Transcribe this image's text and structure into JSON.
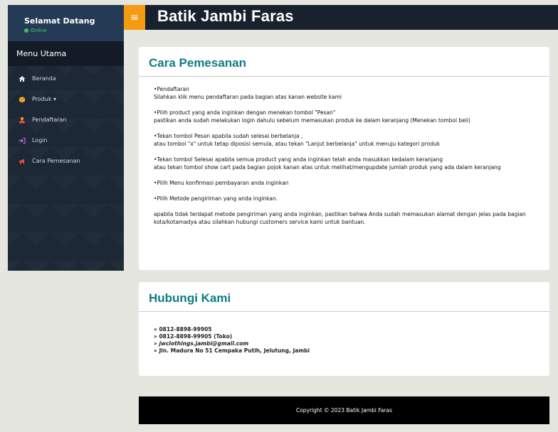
{
  "sidebar": {
    "welcome": "Selamat Datang",
    "status": "Online",
    "menu_header": "Menu Utama",
    "items": [
      {
        "label": "Beranda",
        "icon": "home-icon"
      },
      {
        "label": "Produk ▾",
        "icon": "box-icon"
      },
      {
        "label": "Pendaftaran",
        "icon": "user-icon"
      },
      {
        "label": "Login",
        "icon": "login-icon"
      },
      {
        "label": "Cara Pemesanan",
        "icon": "bullhorn-icon"
      }
    ]
  },
  "header": {
    "toggle": "≡",
    "brand": "Batik Jambi Faras"
  },
  "cara": {
    "title": "Cara Pemesanan",
    "p1a": "•Pendaftaran",
    "p1b": "Silahkan klik menu pendaftaran pada bagian atas kanan website kami",
    "p2a": "•Pilih product yang anda inginkan dengan menekan tombol \"Pesan\"",
    "p2b": "pastikan anda sudah melakukan login dahulu sebelum memasukan produk ke dalam keranjang (Menekan tombol beli)",
    "p3a": "•Tekan tombol Pesan apabila sudah selesai berbelanja ,",
    "p3b": "atau tombol \"x\" untuk tetap diposisi semula, atau tekan \"Lanjut berbelanja\" untuk menuju kategori produk",
    "p4a": "•Tekan tombol Selesai apabila semua product yang anda inginkan telah anda masukkan kedalam keranjang",
    "p4b": "atau tekan tombol show cart pada bagian pojok kanan atas untuk melihat/mengupdate jumlah produk yang ada dalam keranjang",
    "p5": "•Pilih Menu konfirmasi pembayaran anda inginkan",
    "p6": "•Pilih Metode pengiriman yang anda inginkan.",
    "p7": "apabila tidak terdapat metode pengiriman yang anda inginkan, pastikan bahwa Anda sudah memasukan alamat dengan jelas pada bagian kota/kotamadya atau silahkan hubungi customers service kami untuk bantuan."
  },
  "hubungi": {
    "title": "Hubungi Kami",
    "lines": [
      "» 0812-8898-99905",
      "» 0812-8898-99905 (Toko)",
      "» jwclothings.jambi@gmail.com",
      "» Jln. Madura No 51 Cempaka Putih, Jelutung, Jambi"
    ]
  },
  "footer": {
    "text": "Copyright © 2023 Batik Jambi Faras"
  }
}
